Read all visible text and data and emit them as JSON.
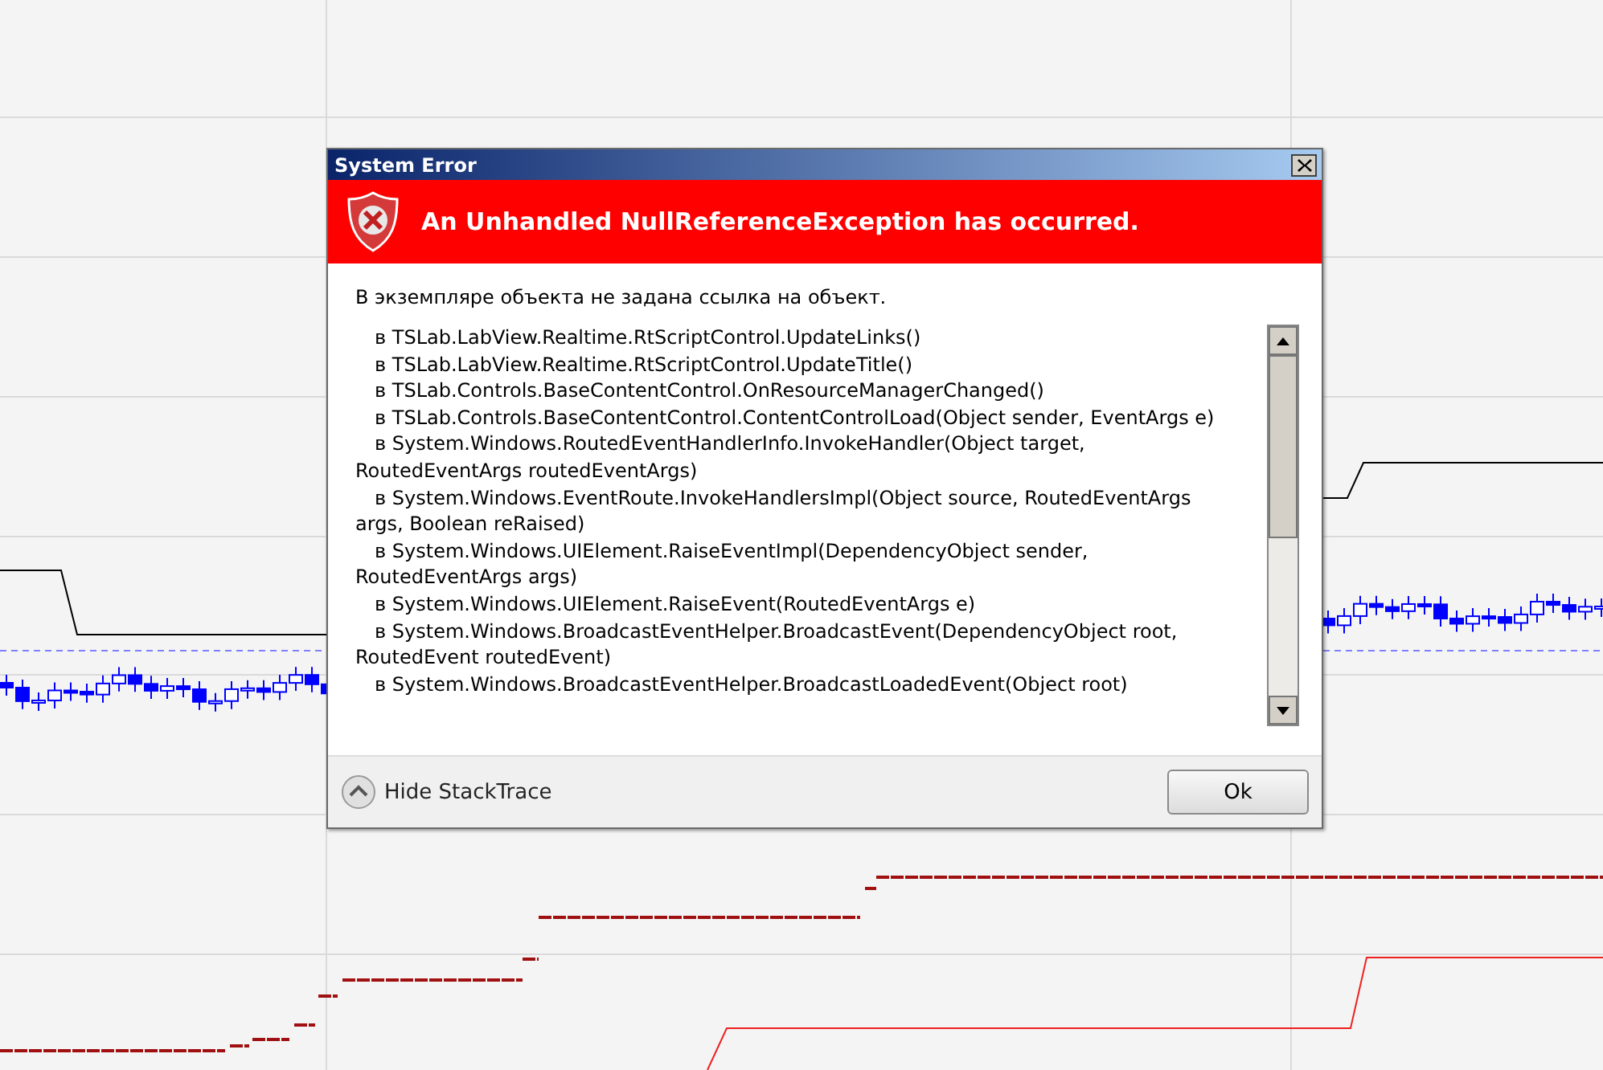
{
  "dialog": {
    "title": "System Error",
    "header": "An Unhandled NullReferenceException has occurred.",
    "message": "В экземпляре объекта не задана ссылка на объект.",
    "stack_trace": [
      "в TSLab.LabView.Realtime.RtScriptControl.UpdateLinks()",
      "в TSLab.LabView.Realtime.RtScriptControl.UpdateTitle()",
      "в TSLab.Controls.BaseContentControl.OnResourceManagerChanged()",
      "в TSLab.Controls.BaseContentControl.ContentControlLoad(Object sender, EventArgs e)",
      "в System.Windows.RoutedEventHandlerInfo.InvokeHandler(Object target, RoutedEventArgs routedEventArgs)",
      "в System.Windows.EventRoute.InvokeHandlersImpl(Object source, RoutedEventArgs args, Boolean reRaised)",
      "в System.Windows.UIElement.RaiseEventImpl(DependencyObject sender, RoutedEventArgs args)",
      "в System.Windows.UIElement.RaiseEvent(RoutedEventArgs e)",
      "в System.Windows.BroadcastEventHelper.BroadcastEvent(DependencyObject root, RoutedEvent routedEvent)",
      "в System.Windows.BroadcastEventHelper.BroadcastLoadedEvent(Object root)"
    ],
    "toggle_label": "Hide StackTrace",
    "ok_label": "Ok"
  }
}
